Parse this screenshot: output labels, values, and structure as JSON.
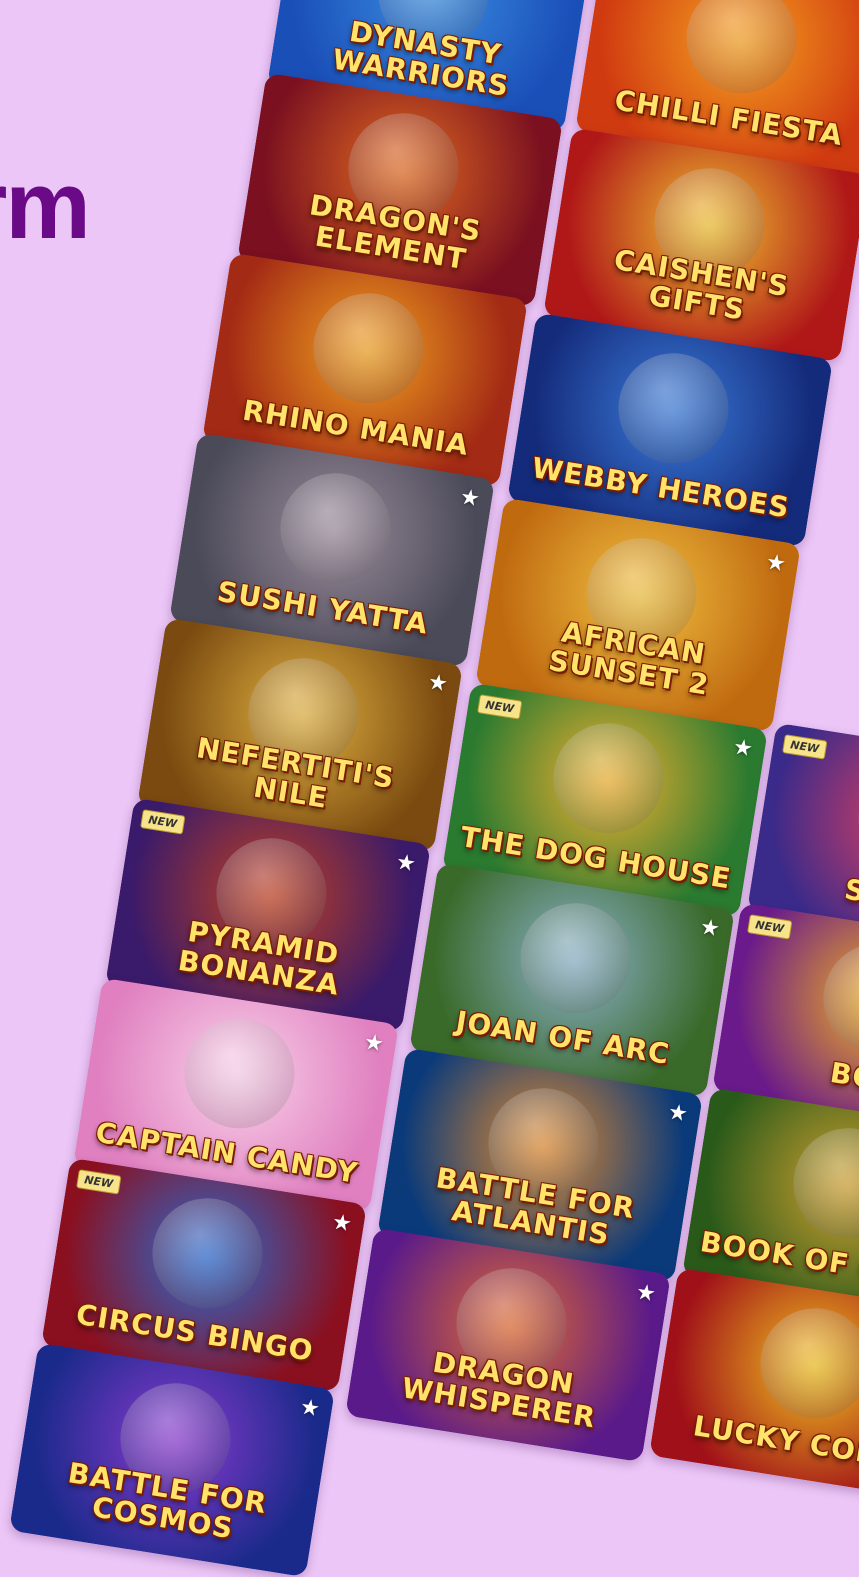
{
  "headline": "rm",
  "badge_text": "NEW",
  "star_glyph": "★",
  "games": [
    {
      "title": "DYNASTY WARRIORS",
      "star": false,
      "new": false,
      "colors": [
        "#1a4fb8",
        "#3a8be0"
      ]
    },
    {
      "title": "CHILLI FIESTA",
      "star": false,
      "new": false,
      "colors": [
        "#d03a10",
        "#f5a020"
      ]
    },
    {
      "title": "DRAGON'S ELEMENT",
      "star": false,
      "new": false,
      "colors": [
        "#7a1020",
        "#e06a20"
      ]
    },
    {
      "title": "CAISHEN'S GIFTS",
      "star": false,
      "new": false,
      "colors": [
        "#b01818",
        "#f0c030"
      ]
    },
    {
      "title": "RHINO MANIA",
      "star": false,
      "new": false,
      "colors": [
        "#a32a14",
        "#f0a020"
      ]
    },
    {
      "title": "WEBBY HEROES",
      "star": false,
      "new": false,
      "colors": [
        "#142a7a",
        "#3a7ad8"
      ]
    },
    {
      "title": "SUSHI YATTA",
      "star": true,
      "new": false,
      "colors": [
        "#4a4a58",
        "#9a8a9a"
      ]
    },
    {
      "title": "AFRICAN SUNSET 2",
      "star": true,
      "new": false,
      "colors": [
        "#c06a10",
        "#f0c040"
      ]
    },
    {
      "title": "NEFERTITI'S NILE",
      "star": true,
      "new": false,
      "colors": [
        "#7a4a10",
        "#e0b040"
      ]
    },
    {
      "title": "THE DOG HOUSE",
      "star": true,
      "new": true,
      "colors": [
        "#2a7a30",
        "#f0b030"
      ]
    },
    {
      "title": "PYRAMID BONANZA",
      "star": true,
      "new": true,
      "colors": [
        "#3a1a6a",
        "#c04020"
      ]
    },
    {
      "title": "JOAN OF ARC",
      "star": true,
      "new": false,
      "colors": [
        "#3a6a2a",
        "#8ab0c8"
      ]
    },
    {
      "title": "CAPTAIN CANDY",
      "star": true,
      "new": false,
      "colors": [
        "#e080c0",
        "#f8d0e8"
      ]
    },
    {
      "title": "BATTLE FOR ATLANTIS",
      "star": true,
      "new": false,
      "colors": [
        "#0a3a7a",
        "#e08a30"
      ]
    },
    {
      "title": "CIRCUS BINGO",
      "star": true,
      "new": true,
      "colors": [
        "#8a1020",
        "#2a6ad0"
      ]
    },
    {
      "title": "DRAGON WHISPERER",
      "star": true,
      "new": false,
      "colors": [
        "#5a1a8a",
        "#e06a30"
      ]
    },
    {
      "title": "BATTLE FOR COSMOS",
      "star": true,
      "new": false,
      "colors": [
        "#1a2a8a",
        "#8a3ad0"
      ]
    },
    {
      "title": "SWEET",
      "star": false,
      "new": true,
      "colors": [
        "#3a2a8a",
        "#e04060"
      ]
    },
    {
      "title": "BON",
      "star": false,
      "new": true,
      "colors": [
        "#6a1a8a",
        "#f0b020"
      ]
    },
    {
      "title": "BOOK OF OZIRIS",
      "star": false,
      "new": false,
      "colors": [
        "#2a5a1a",
        "#d0a030"
      ]
    },
    {
      "title": "LUCKY COINS",
      "star": false,
      "new": false,
      "colors": [
        "#a01018",
        "#f0c020"
      ]
    }
  ]
}
